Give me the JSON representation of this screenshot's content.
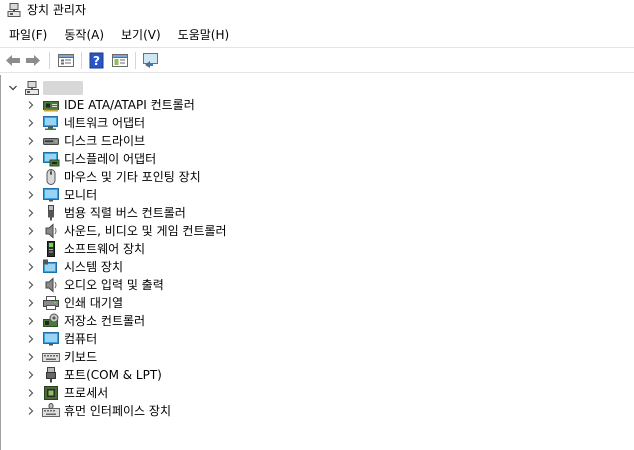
{
  "window": {
    "title": "장치 관리자"
  },
  "menu": [
    {
      "label": "파일(F)"
    },
    {
      "label": "동작(A)"
    },
    {
      "label": "보기(V)"
    },
    {
      "label": "도움말(H)"
    }
  ],
  "toolbar": {
    "buttons": [
      "back-arrow-icon",
      "forward-arrow-icon",
      "properties-icon",
      "help-icon",
      "view-icon",
      "scan-hardware-icon"
    ]
  },
  "tree": {
    "root_expanded": true,
    "root_icon": "computer-root-icon",
    "categories": [
      {
        "label": "IDE ATA/ATAPI 컨트롤러",
        "icon": "ide-controller-icon"
      },
      {
        "label": "네트워크 어댑터",
        "icon": "network-adapter-icon"
      },
      {
        "label": "디스크 드라이브",
        "icon": "disk-drive-icon"
      },
      {
        "label": "디스플레이 어댑터",
        "icon": "display-adapter-icon"
      },
      {
        "label": "마우스 및 기타 포인팅 장치",
        "icon": "mouse-icon"
      },
      {
        "label": "모니터",
        "icon": "monitor-icon"
      },
      {
        "label": "범용 직렬 버스 컨트롤러",
        "icon": "usb-icon"
      },
      {
        "label": "사운드, 비디오 및 게임 컨트롤러",
        "icon": "speaker-icon"
      },
      {
        "label": "소프트웨어 장치",
        "icon": "software-device-icon"
      },
      {
        "label": "시스템 장치",
        "icon": "system-device-icon"
      },
      {
        "label": "오디오 입력 및 출력",
        "icon": "audio-io-icon"
      },
      {
        "label": "인쇄 대기열",
        "icon": "printer-icon"
      },
      {
        "label": "저장소 컨트롤러",
        "icon": "storage-controller-icon"
      },
      {
        "label": "컴퓨터",
        "icon": "computer-icon"
      },
      {
        "label": "키보드",
        "icon": "keyboard-icon"
      },
      {
        "label": "포트(COM & LPT)",
        "icon": "port-icon"
      },
      {
        "label": "프로세서",
        "icon": "processor-icon"
      },
      {
        "label": "휴먼 인터페이스 장치",
        "icon": "hid-icon"
      }
    ]
  }
}
